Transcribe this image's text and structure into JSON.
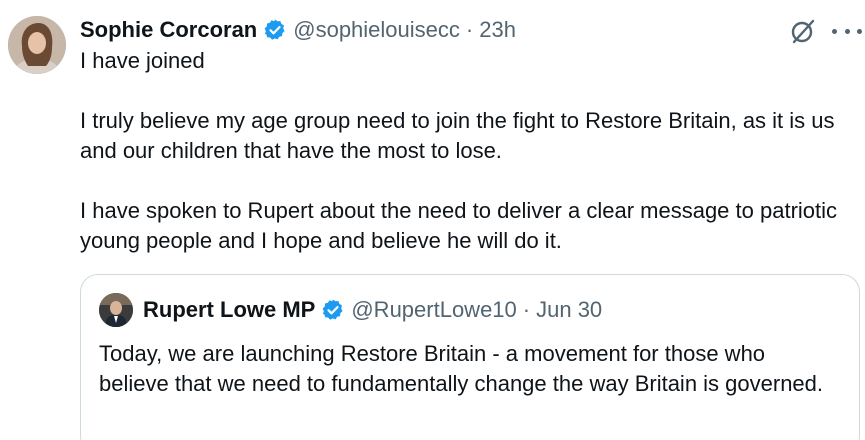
{
  "tweet": {
    "author_name": "Sophie Corcoran",
    "handle": "@sophielouisecc",
    "separator": "·",
    "time": "23h",
    "paragraphs": [
      "I have joined",
      "I truly believe my age group need to join the fight to Restore Britain, as it is us and our children that have the most to lose.",
      "I have spoken to Rupert about the need to deliver a clear message to patriotic young people and I hope and believe he will do it."
    ]
  },
  "quoted_tweet": {
    "author_name": "Rupert Lowe MP",
    "handle": "@RupertLowe10",
    "separator": "·",
    "time": "Jun 30",
    "text": "Today, we are launching Restore Britain - a movement for those who believe that we need to fundamentally change the way Britain is governed."
  },
  "icons": {
    "verified": "verified-badge-icon",
    "grok": "grok-icon",
    "more": "more-options-icon"
  },
  "colors": {
    "verified_blue": "#1d9bf0",
    "secondary_text": "#536471",
    "border": "#cfd9de"
  }
}
